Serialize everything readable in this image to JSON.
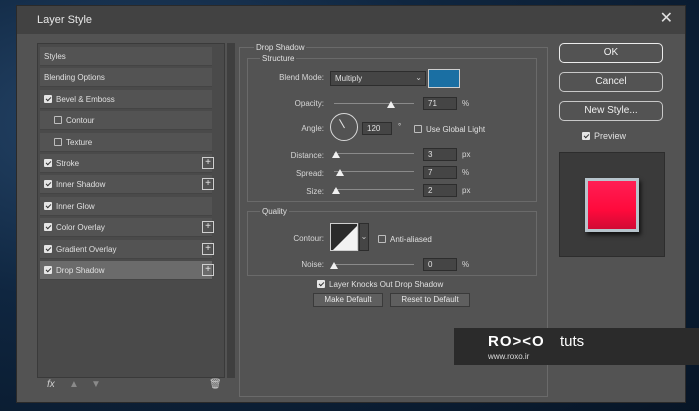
{
  "window": {
    "title": "Layer Style"
  },
  "styles": {
    "items": [
      {
        "label": "Styles",
        "checkbox": false,
        "checked": false,
        "plus": false,
        "selected": false,
        "indent": false
      },
      {
        "label": "Blending Options",
        "checkbox": false,
        "checked": false,
        "plus": false,
        "selected": false,
        "indent": false
      },
      {
        "label": "Bevel & Emboss",
        "checkbox": true,
        "checked": true,
        "plus": false,
        "selected": false,
        "indent": false
      },
      {
        "label": "Contour",
        "checkbox": true,
        "checked": false,
        "plus": false,
        "selected": false,
        "indent": true
      },
      {
        "label": "Texture",
        "checkbox": true,
        "checked": false,
        "plus": false,
        "selected": false,
        "indent": true
      },
      {
        "label": "Stroke",
        "checkbox": true,
        "checked": true,
        "plus": true,
        "selected": false,
        "indent": false
      },
      {
        "label": "Inner Shadow",
        "checkbox": true,
        "checked": true,
        "plus": true,
        "selected": false,
        "indent": false
      },
      {
        "label": "Inner Glow",
        "checkbox": true,
        "checked": true,
        "plus": false,
        "selected": false,
        "indent": false
      },
      {
        "label": "Color Overlay",
        "checkbox": true,
        "checked": true,
        "plus": true,
        "selected": false,
        "indent": false
      },
      {
        "label": "Gradient Overlay",
        "checkbox": true,
        "checked": true,
        "plus": true,
        "selected": false,
        "indent": false
      },
      {
        "label": "Drop Shadow",
        "checkbox": true,
        "checked": true,
        "plus": true,
        "selected": true,
        "indent": false
      }
    ],
    "footer": {
      "fx": "fx",
      "up": "▲",
      "down": "▼",
      "trash": "🗑"
    }
  },
  "drop_shadow": {
    "title": "Drop Shadow",
    "structure": {
      "title": "Structure",
      "blend_mode_label": "Blend Mode:",
      "blend_mode_value": "Multiply",
      "shadow_color": "#1a6fa3",
      "opacity_label": "Opacity:",
      "opacity_value": "71",
      "opacity_unit": "%",
      "opacity_level": 0.71,
      "angle_label": "Angle:",
      "angle_value": "120",
      "angle_unit": "°",
      "use_global_light": "Use Global Light",
      "use_global_light_checked": false,
      "distance_label": "Distance:",
      "distance_value": "3",
      "distance_unit": "px",
      "distance_level": 0.03,
      "spread_label": "Spread:",
      "spread_value": "7",
      "spread_unit": "%",
      "spread_level": 0.07,
      "size_label": "Size:",
      "size_value": "2",
      "size_unit": "px",
      "size_level": 0.02
    },
    "quality": {
      "title": "Quality",
      "contour_label": "Contour:",
      "anti_aliased": "Anti-aliased",
      "anti_aliased_checked": false,
      "noise_label": "Noise:",
      "noise_value": "0",
      "noise_unit": "%",
      "noise_level": 0
    },
    "knocks_out": "Layer Knocks Out Drop Shadow",
    "knocks_out_checked": true,
    "make_default": "Make Default",
    "reset_default": "Reset to Default"
  },
  "buttons": {
    "ok": "OK",
    "cancel": "Cancel",
    "new_style": "New Style..."
  },
  "preview": {
    "label": "Preview",
    "checked": true
  },
  "watermark": {
    "brand": "RO><O",
    "tuts": "tuts",
    "url": "www.roxo.ir"
  }
}
